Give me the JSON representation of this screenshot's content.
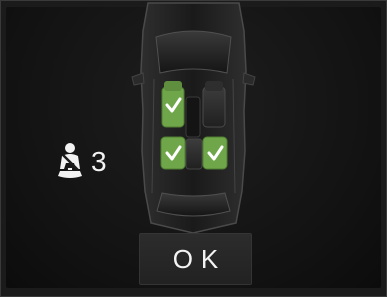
{
  "seatbelt_status": {
    "icon": "seatbelt-icon",
    "count": "3"
  },
  "seats": [
    {
      "position": "front-left",
      "status": "checked"
    },
    {
      "position": "front-right",
      "status": "empty"
    },
    {
      "position": "rear-left",
      "status": "checked"
    },
    {
      "position": "rear-center",
      "status": "empty"
    },
    {
      "position": "rear-right",
      "status": "checked"
    }
  ],
  "ok_button": {
    "label": "OK"
  },
  "colors": {
    "check_green": "#6fa64a",
    "screen_bg": "#1b1b1b",
    "text": "#f2f2f2"
  }
}
